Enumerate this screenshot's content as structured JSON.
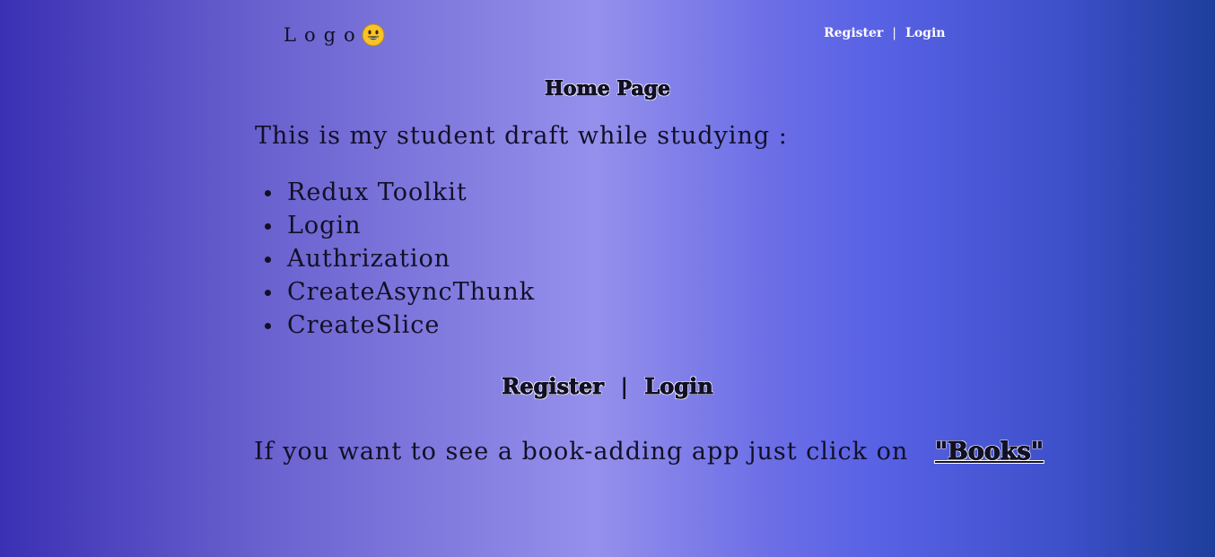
{
  "header": {
    "logo_text": "Logo",
    "logo_icon": "grinning-face-icon",
    "nav": {
      "register_label": "Register",
      "separator": "|",
      "login_label": "Login"
    }
  },
  "main": {
    "title": "Home Page",
    "intro": "This is my student draft while studying :",
    "topics": [
      "Redux Toolkit",
      "Login",
      "Authrization",
      "CreateAsyncThunk",
      "CreateSlice"
    ],
    "auth_links": {
      "register_label": "Register",
      "separator": "|",
      "login_label": "Login"
    },
    "books_prompt": "If you want to see a book-adding app just click on",
    "books_link_label": "\"Books\""
  },
  "colors": {
    "text": "#121026",
    "nav_text": "#ffffff",
    "gradient_left": "#3a30b4",
    "gradient_center": "#9590ec",
    "gradient_right": "#1e3e9c"
  }
}
